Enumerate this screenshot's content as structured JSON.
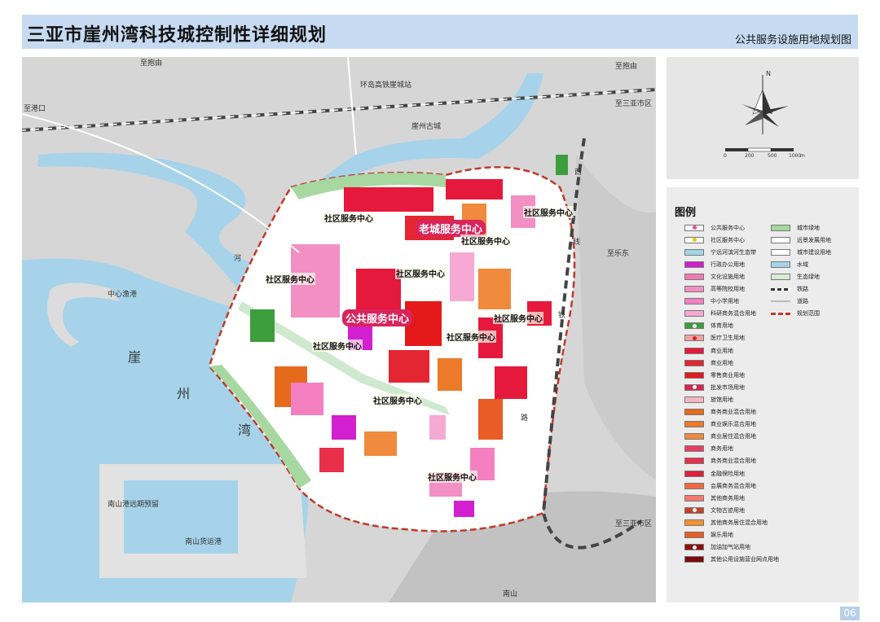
{
  "header": {
    "title": "三亚市崖州湾科技城控制性详细规划",
    "subtitle": "公共服务设施用地规划图"
  },
  "map_labels": {
    "to_baoyou_top": "至抱由",
    "to_baoyou_right": "至抱由",
    "to_gangkou": "至港口",
    "railway": "环岛高铁崖城站",
    "to_sanya_top": "至三亚市区",
    "to_sanya_bottom": "至三亚市区",
    "yacheng_old": "崖州古城",
    "to_ledong": "至乐东",
    "zhongxin_yu": "中心渔港",
    "bay_char1": "崖",
    "bay_char2": "州",
    "bay_char3": "湾",
    "nanshan_port1": "南山港远期预留",
    "nanshan_port2": "南山货运港",
    "nanshan": "南山",
    "river_he": "河",
    "road_xian": "线",
    "road_lu": "路",
    "road_tie": "铁",
    "road_xi": "西"
  },
  "centers": {
    "old_city": "老城服务中心",
    "public": "公共服务中心",
    "community": "社区服务中心"
  },
  "compass": {
    "north": "N",
    "scale_0": "0",
    "scale_200": "200",
    "scale_500": "500",
    "scale_1000": "1000",
    "scale_unit": "m"
  },
  "legend": {
    "title": "图例",
    "left_items": [
      {
        "label": "公共服务中心",
        "color": "#ffffff",
        "mark": "#e84c8b"
      },
      {
        "label": "社区服务中心",
        "color": "#ffffff",
        "mark": "#f2c200"
      },
      {
        "label": "宁远河滨河生态带",
        "color": "#9fd6e8"
      },
      {
        "label": "行政办公用地",
        "color": "#d21fcf"
      },
      {
        "label": "文化设施用地",
        "color": "#f17ab6"
      },
      {
        "label": "高等院校用地",
        "color": "#f28fc3"
      },
      {
        "label": "中小学用地",
        "color": "#f47fc1"
      },
      {
        "label": "科研商务混合用地",
        "color": "#f5a9d3"
      },
      {
        "label": "体育用地",
        "color": "#3c9e3c",
        "mark": "#ffffff"
      },
      {
        "label": "医疗卫生用地",
        "color": "#f3a3a3",
        "mark": "#e02020"
      },
      {
        "label": "商业用地",
        "color": "#e5193c"
      },
      {
        "label": "商业用地",
        "color": "#e32632"
      },
      {
        "label": "零售商业用地",
        "color": "#e41a1a"
      },
      {
        "label": "批发市场用地",
        "color": "#d9244f",
        "mark": "#ffffff"
      },
      {
        "label": "旅馆用地",
        "color": "#f6b6c6"
      },
      {
        "label": "商务商业混合用地",
        "color": "#e66a1c"
      },
      {
        "label": "商业娱乐混合用地",
        "color": "#ec7a2a"
      },
      {
        "label": "商业居住混合用地",
        "color": "#f08a3c"
      },
      {
        "label": "商务用地",
        "color": "#e64060"
      },
      {
        "label": "商务商业混合用地",
        "color": "#e8304a"
      },
      {
        "label": "金融保险用地",
        "color": "#e0203c"
      },
      {
        "label": "会展商务混合用地",
        "color": "#f0683c"
      },
      {
        "label": "其他商务用地",
        "color": "#f37a6e"
      },
      {
        "label": "文物古迹用地",
        "color": "#c8402a",
        "mark": "#ffffff"
      },
      {
        "label": "其他商务居住混合用地",
        "color": "#f49030"
      },
      {
        "label": "娱乐用地",
        "color": "#e85c26"
      },
      {
        "label": "加油加气站用地",
        "color": "#8c1010",
        "mark": "#ffffff"
      },
      {
        "label": "其他公用设施营业网点用地",
        "color": "#7a0a0a"
      }
    ],
    "right_items": [
      {
        "label": "城市绿地",
        "color": "#a6d8a0"
      },
      {
        "label": "远景发展用地",
        "color": "#ffffff"
      },
      {
        "label": "城市建设用地",
        "color": "#ffffff"
      },
      {
        "label": "水域",
        "color": "#a6d3ea"
      },
      {
        "label": "生态绿地",
        "color": "#d9ecd2"
      },
      {
        "label": "铁路",
        "color": "line-rail"
      },
      {
        "label": "道路",
        "color": "line-road"
      },
      {
        "label": "规划范围",
        "color": "line-boundary"
      }
    ]
  },
  "page_number": "06",
  "colors": {
    "header_bg": "#c6dbf1",
    "water": "#a6d3ea",
    "green": "#a6d8a0",
    "boundary": "#c0392b"
  }
}
